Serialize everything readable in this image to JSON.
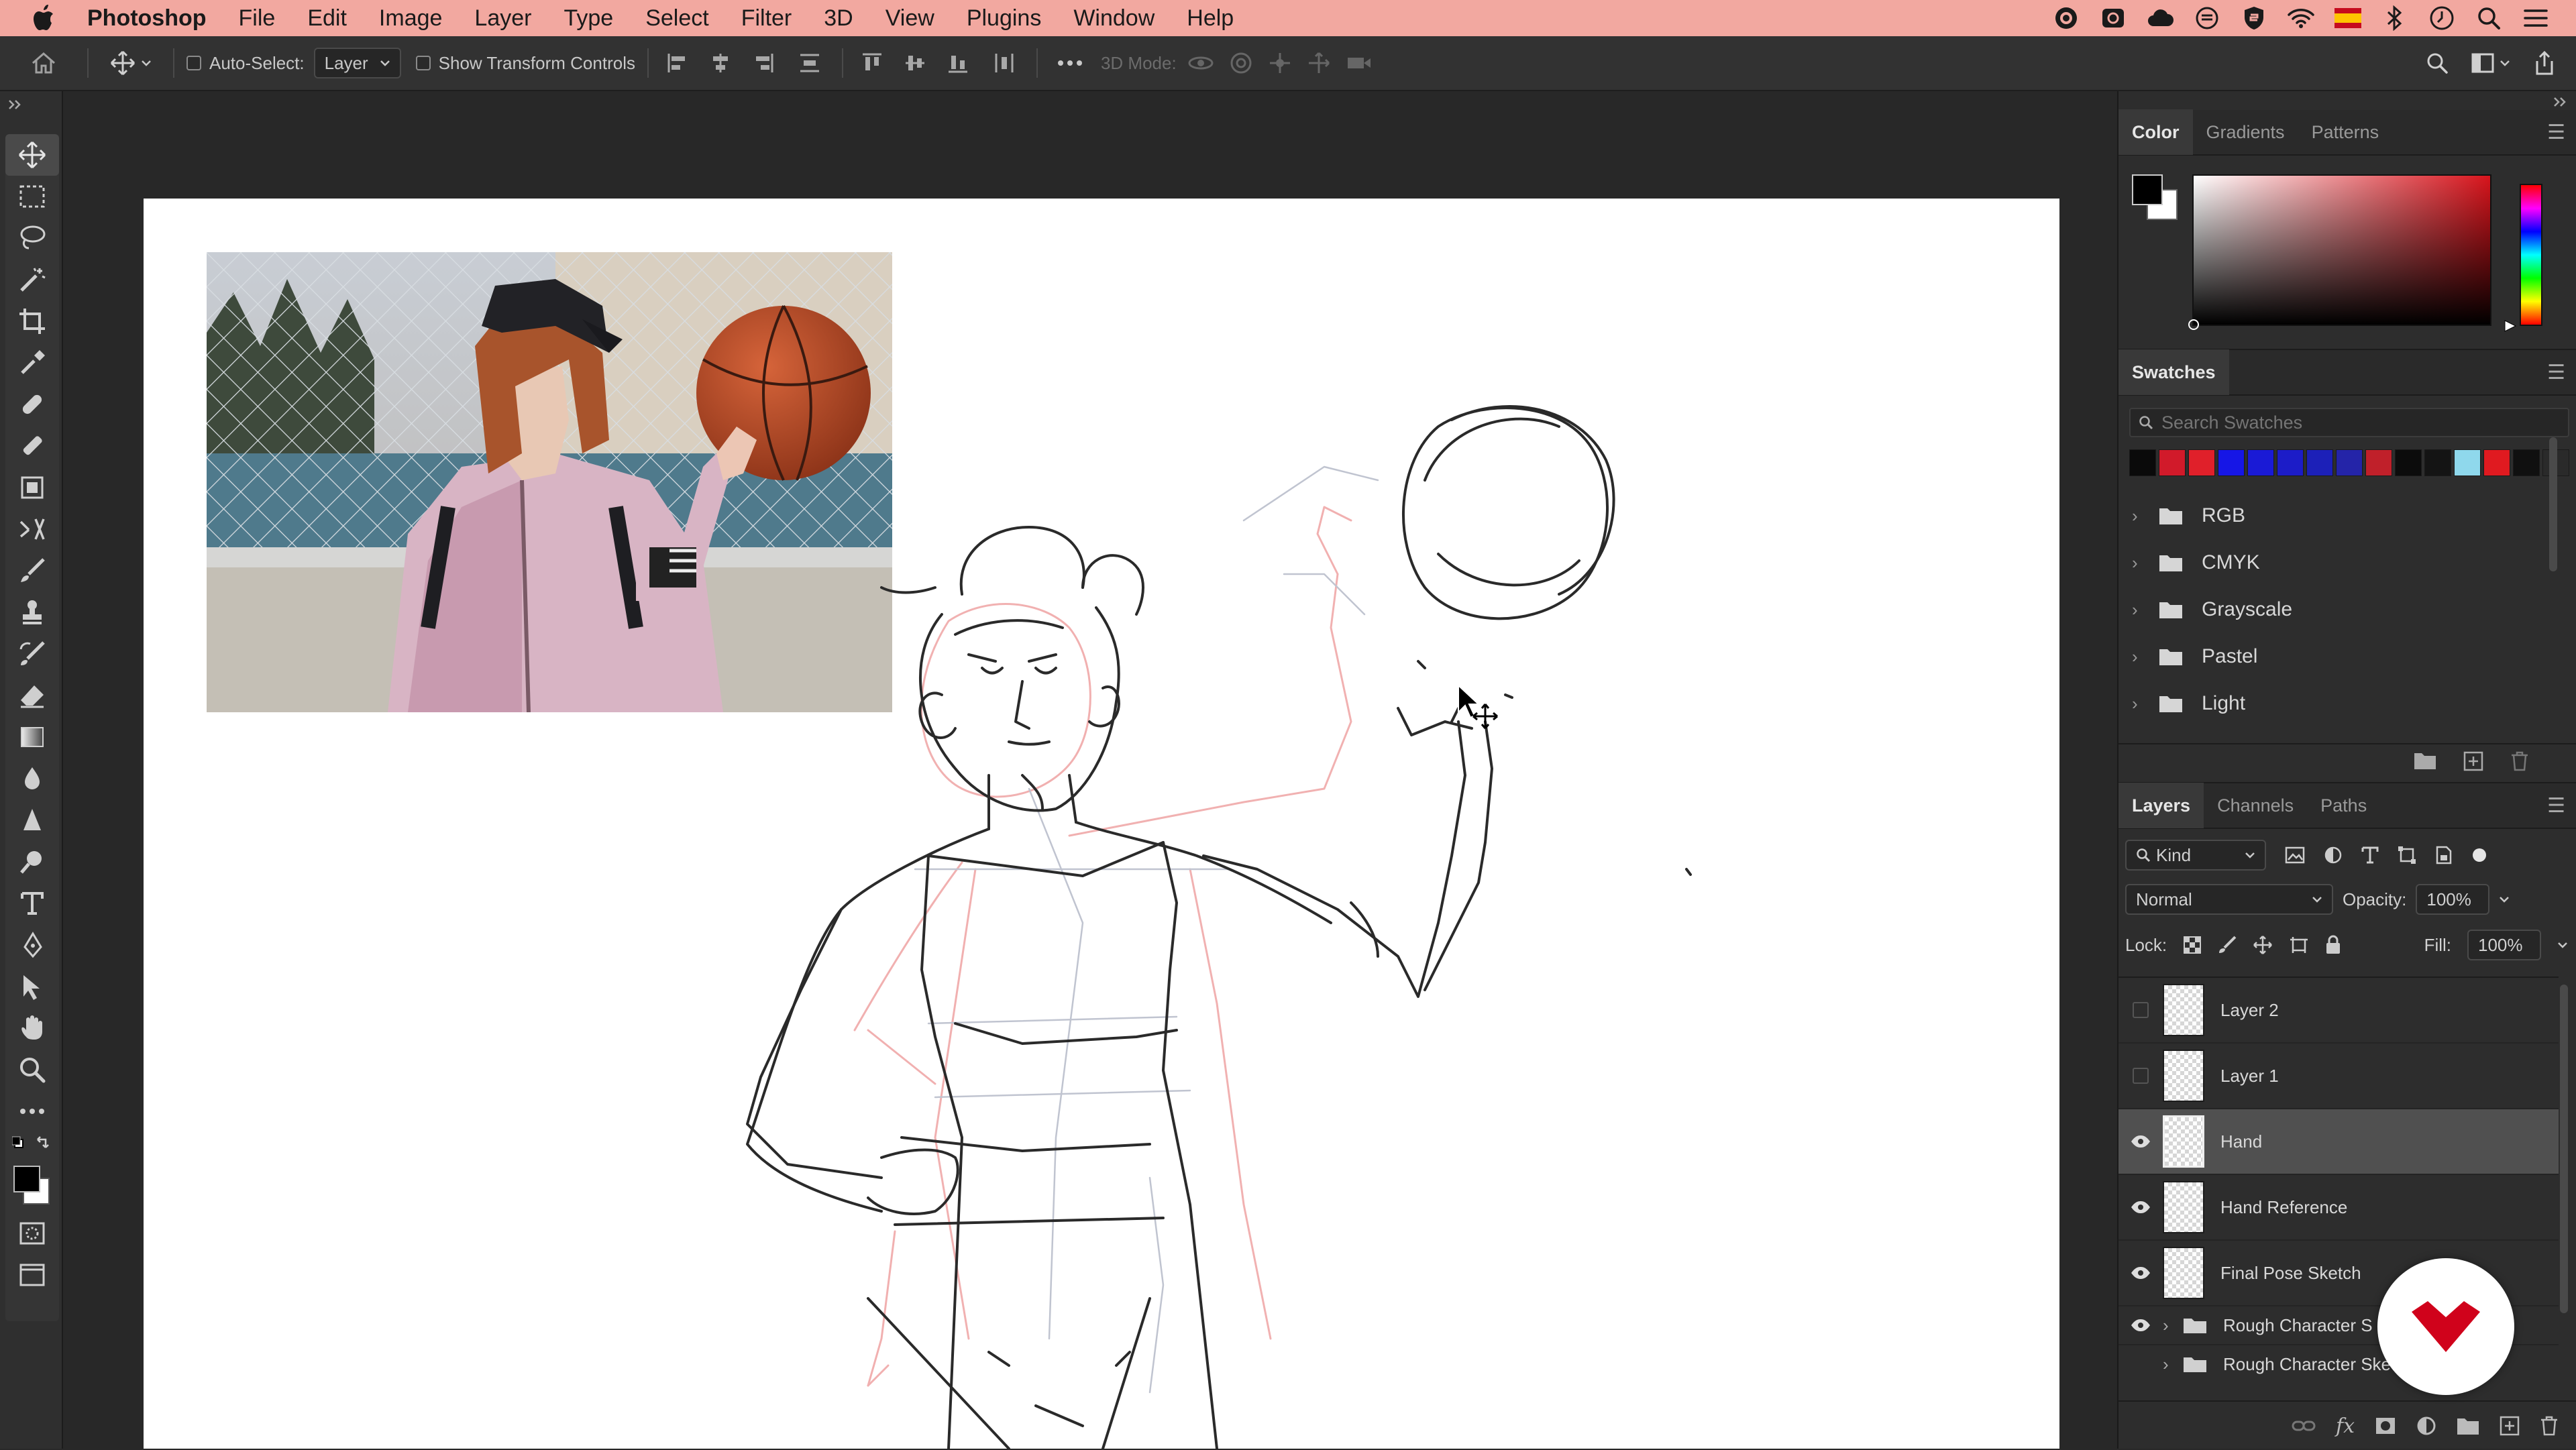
{
  "menubar": {
    "app_name": "Photoshop",
    "items": [
      "File",
      "Edit",
      "Image",
      "Layer",
      "Type",
      "Select",
      "Filter",
      "3D",
      "View",
      "Plugins",
      "Window",
      "Help"
    ]
  },
  "options_bar": {
    "auto_select_label": "Auto-Select:",
    "auto_select_value": "Layer",
    "show_transform_label": "Show Transform Controls",
    "mode_3d_label": "3D Mode:"
  },
  "color_panel": {
    "tabs": [
      "Color",
      "Gradients",
      "Patterns"
    ],
    "foreground": "#000000",
    "background": "#ffffff",
    "hue_color": "#d8141c"
  },
  "swatches_panel": {
    "title": "Swatches",
    "search_placeholder": "Search Swatches",
    "recent_colors": [
      "#0a0a0a",
      "#d11a2a",
      "#e0202a",
      "#1616e6",
      "#1a1ad6",
      "#1c1cc8",
      "#1c20b8",
      "#2424a8",
      "#c0202a",
      "#0c0c0c",
      "#141414",
      "#8fd8ec",
      "#e01a20",
      "#101010",
      "#2a2a2a"
    ],
    "folders": [
      "RGB",
      "CMYK",
      "Grayscale",
      "Pastel",
      "Light"
    ]
  },
  "layers_panel": {
    "tabs": [
      "Layers",
      "Channels",
      "Paths"
    ],
    "filter_kind": "Kind",
    "blend_mode": "Normal",
    "opacity_label": "Opacity:",
    "opacity_value": "100%",
    "lock_label": "Lock:",
    "fill_label": "Fill:",
    "fill_value": "100%",
    "layers": [
      {
        "name": "Layer 2",
        "visible": false,
        "selected": false
      },
      {
        "name": "Layer 1",
        "visible": false,
        "selected": false
      },
      {
        "name": "Hand",
        "visible": true,
        "selected": true
      },
      {
        "name": "Hand Reference",
        "visible": true,
        "selected": false
      },
      {
        "name": "Final Pose Sketch",
        "visible": true,
        "selected": false
      }
    ],
    "groups": [
      {
        "name": "Rough Character S",
        "visible": true
      },
      {
        "name": "Rough Character Ske",
        "visible": false
      }
    ]
  },
  "theme": {
    "menubar_bg": "#f2a8a0",
    "ui_dark": "#2d2d2d",
    "logo_red": "#d0021b"
  }
}
